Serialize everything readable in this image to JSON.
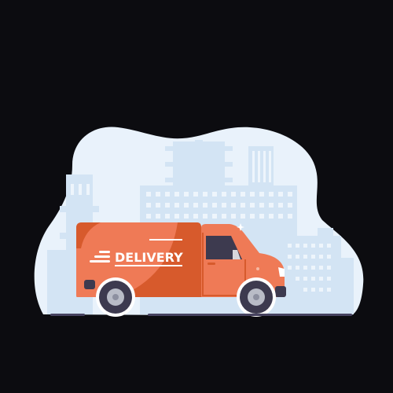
{
  "illustration": {
    "van_text": "DELIVERY"
  },
  "colors": {
    "background": "#0c0c10",
    "blob": "#e9f2fb",
    "buildings": "#d3e4f4",
    "building_windows": "#eef5fc",
    "van_body": "#ef7a56",
    "van_shadow": "#d75a2c",
    "tire": "#3d3a4f",
    "hub": "#b9bcc7",
    "ground": "#474360"
  }
}
